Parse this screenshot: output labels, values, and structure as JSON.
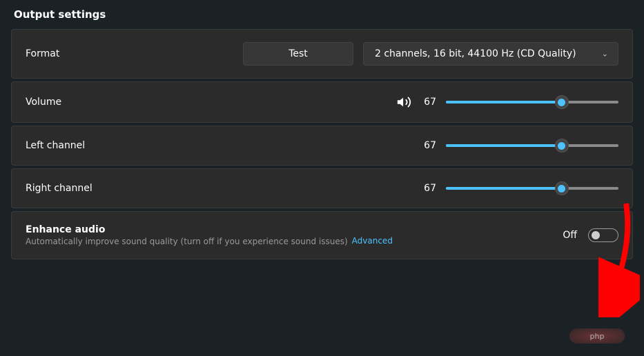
{
  "section_title": "Output settings",
  "format": {
    "label": "Format",
    "test_label": "Test",
    "dropdown_value": "2 channels, 16 bit, 44100 Hz (CD Quality)"
  },
  "volume": {
    "label": "Volume",
    "value": "67",
    "percent": 67
  },
  "left_channel": {
    "label": "Left channel",
    "value": "67",
    "percent": 67
  },
  "right_channel": {
    "label": "Right channel",
    "value": "67",
    "percent": 67
  },
  "enhance": {
    "title": "Enhance audio",
    "subtitle": "Automatically improve sound quality (turn off if you experience sound issues)",
    "advanced_label": "Advanced",
    "state_label": "Off"
  },
  "watermark": "php"
}
